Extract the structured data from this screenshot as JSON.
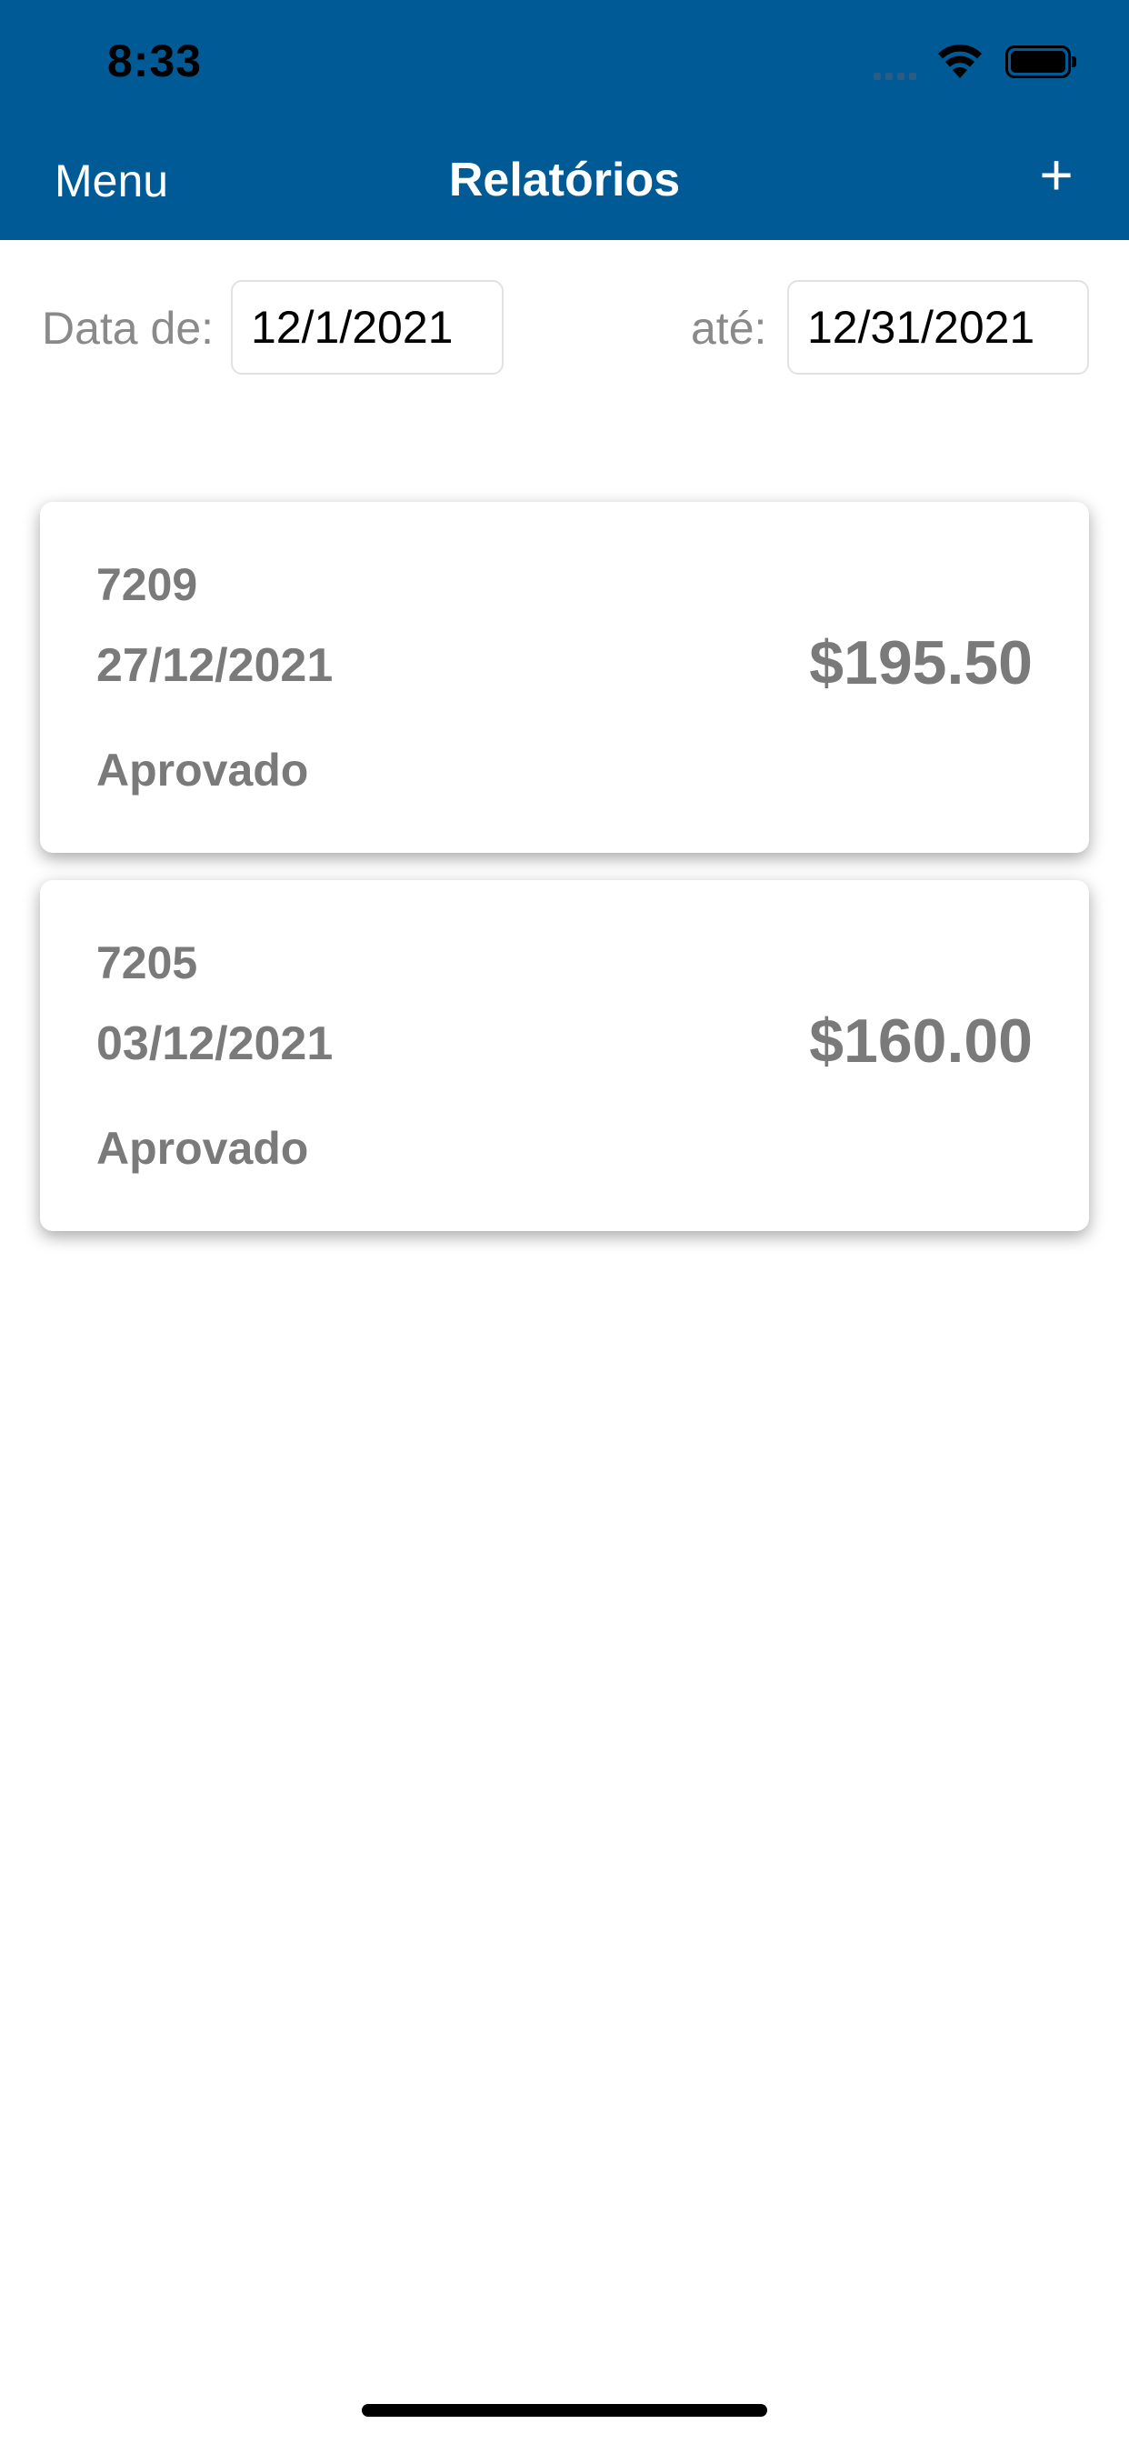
{
  "status_bar": {
    "time": "8:33"
  },
  "nav": {
    "menu_label": "Menu",
    "title": "Relatórios",
    "add_label": "+"
  },
  "filter": {
    "from_label": "Data de:",
    "from_value": "12/1/2021",
    "to_label": "até:",
    "to_value": "12/31/2021"
  },
  "reports": [
    {
      "id": "7209",
      "date": "27/12/2021",
      "status": "Aprovado",
      "amount": "$195.50"
    },
    {
      "id": "7205",
      "date": "03/12/2021",
      "status": "Aprovado",
      "amount": "$160.00"
    }
  ],
  "colors": {
    "header_bg": "#005a96",
    "header_text": "#ffffff",
    "card_text": "#7a7a7a"
  }
}
